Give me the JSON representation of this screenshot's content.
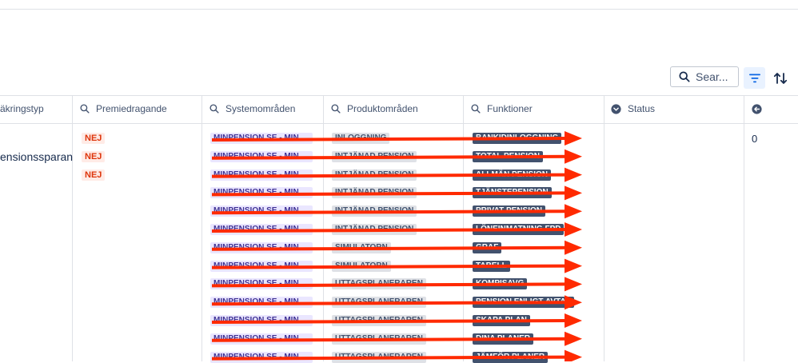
{
  "toolbar": {
    "search_placeholder": "Sear...",
    "icons": [
      "search-icon",
      "filter-icon",
      "sort-icon"
    ]
  },
  "columns": [
    {
      "label": "äkringstyp",
      "icon": ""
    },
    {
      "label": "Premiedragande",
      "icon": "search-icon"
    },
    {
      "label": "Systemområden",
      "icon": "search-icon"
    },
    {
      "label": "Produktområden",
      "icon": "search-icon"
    },
    {
      "label": "Funktioner",
      "icon": "search-icon"
    },
    {
      "label": "Status",
      "icon": "chevron-down-icon"
    },
    {
      "label": "",
      "icon": "arrow-left-icon"
    }
  ],
  "row": {
    "typ": "ensionssparan",
    "premiedragande": [
      "NEJ",
      "NEJ",
      "NEJ"
    ],
    "systemomraden": [
      "MINPENSION.SE - MIN...",
      "MINPENSION.SE - MIN...",
      "MINPENSION.SE - MIN...",
      "MINPENSION.SE - MIN...",
      "MINPENSION.SE - MIN...",
      "MINPENSION.SE - MIN...",
      "MINPENSION.SE - MIN...",
      "MINPENSION.SE - MIN...",
      "MINPENSION.SE - MIN...",
      "MINPENSION.SE - MIN...",
      "MINPENSION.SE - MIN...",
      "MINPENSION.SE - MIN...",
      "MINPENSION.SE - MIN..."
    ],
    "produktomraden": [
      "INLOGGNING",
      "INTJÄNAD PENSION",
      "INTJÄNAD PENSION",
      "INTJÄNAD PENSION",
      "INTJÄNAD PENSION",
      "INTJÄNAD PENSION",
      "SIMULATORN",
      "SIMULATORN",
      "UTTAGSPLANERAREN",
      "UTTAGSPLANERAREN",
      "UTTAGSPLANERAREN",
      "UTTAGSPLANERAREN",
      "UTTAGSPLANERAREN"
    ],
    "funktioner": [
      "BANKIDINLOGGNING",
      "TOTAL PENSION",
      "ALLMÄN PENSION",
      "TJÄNSTEPENSION",
      "PRIVAT PENSION",
      "LÖNEINMATNING FPD",
      "GRAF",
      "TABELL",
      "KOMPISAVG",
      "PENSION ENLIGT AVTAL",
      "SKAPA PLAN",
      "DINA PLANER",
      "JÄMFÖR PLANER"
    ],
    "status": "",
    "last": "0"
  },
  "colors": {
    "annotation_arrow": "#ff2a00",
    "tag_system_bg": "#eae6ff",
    "tag_product_bg": "#dfe1e6",
    "tag_function_bg": "#42526e",
    "nej_bg": "#ffebe6",
    "nej_text": "#de350b",
    "filter_active": "#0c66e4"
  }
}
